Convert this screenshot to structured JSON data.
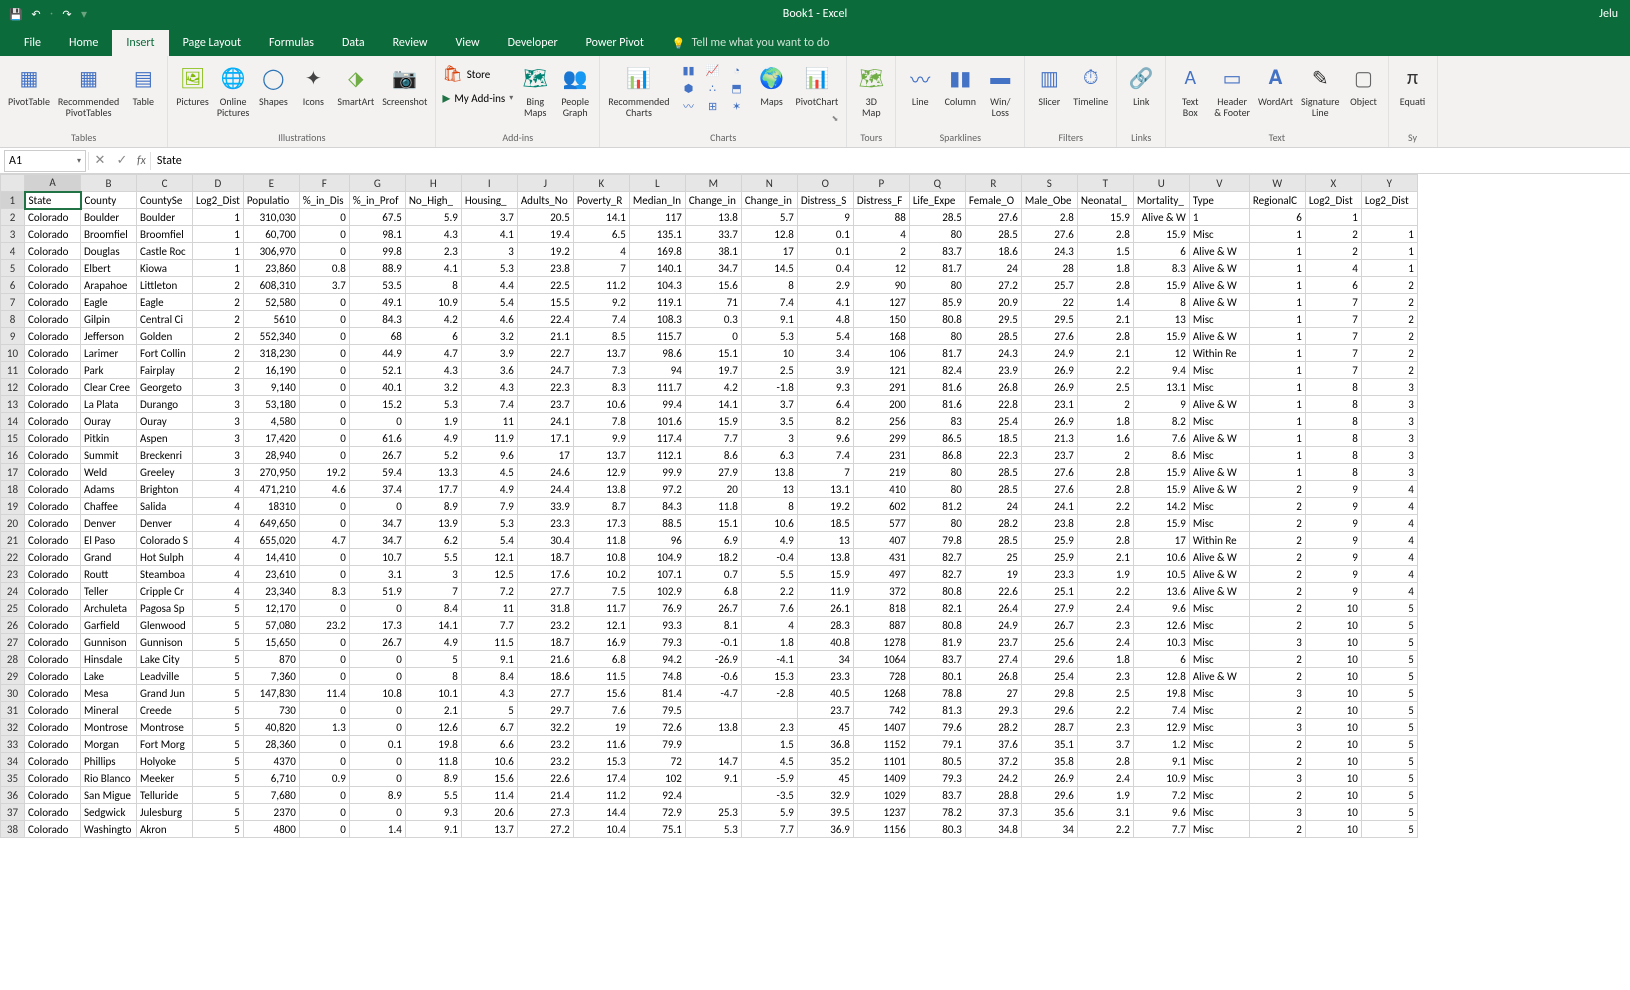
{
  "title": "Book1 - Excel",
  "user": "Jelu",
  "qat": {
    "save": "💾",
    "undo": "↶",
    "redo": "↷"
  },
  "tabs": [
    "File",
    "Home",
    "Insert",
    "Page Layout",
    "Formulas",
    "Data",
    "Review",
    "View",
    "Developer",
    "Power Pivot"
  ],
  "tellme": "Tell me what you want to do",
  "ribbon_groups": {
    "tables": "Tables",
    "illustrations": "Illustrations",
    "addins": "Add-ins",
    "charts": "Charts",
    "tours": "Tours",
    "sparklines": "Sparklines",
    "filters": "Filters",
    "links": "Links",
    "text": "Text",
    "symbols": "Sy"
  },
  "ribbon_btns": {
    "pivot": "PivotTable",
    "recpivot": "Recommended\nPivotTables",
    "table": "Table",
    "pictures": "Pictures",
    "online": "Online\nPictures",
    "shapes": "Shapes",
    "icons": "Icons",
    "smartart": "SmartArt",
    "screenshot": "Screenshot",
    "store": "Store",
    "myaddins": "My Add-ins",
    "bing": "Bing\nMaps",
    "people": "People\nGraph",
    "reccharts": "Recommended\nCharts",
    "maps": "Maps",
    "pivotchart": "PivotChart",
    "3dmap": "3D\nMap",
    "line": "Line",
    "column": "Column",
    "winloss": "Win/\nLoss",
    "slicer": "Slicer",
    "timeline": "Timeline",
    "link": "Link",
    "textbox": "Text\nBox",
    "header": "Header\n& Footer",
    "wordart": "WordArt",
    "signature": "Signature\nLine",
    "object": "Object",
    "equation": "Equati"
  },
  "namebox": "A1",
  "formula": "State",
  "columns": [
    "A",
    "B",
    "C",
    "D",
    "E",
    "F",
    "G",
    "H",
    "I",
    "J",
    "K",
    "L",
    "M",
    "N",
    "O",
    "P",
    "Q",
    "R",
    "S",
    "T",
    "U",
    "V",
    "W",
    "X",
    "Y"
  ],
  "headers": [
    "State",
    "County",
    "CountySe",
    "Log2_Dist",
    "Populatio",
    "%_in_Dis",
    "%_in_Prof",
    "No_High_",
    "Housing_",
    "Adults_No",
    "Poverty_R",
    "Median_In",
    "Change_in",
    "Change_in",
    "Distress_S",
    "Distress_F",
    "Life_Expe",
    "Female_O",
    "Male_Obe",
    "Neonatal_",
    "Mortality_",
    "Type",
    "RegionalC",
    "Log2_Dist",
    "Log2_Dist"
  ],
  "rows": [
    [
      "Colorado",
      "Boulder",
      "Boulder",
      1,
      "310,030",
      0,
      67.5,
      5.9,
      3.7,
      20.5,
      14.1,
      117,
      13.8,
      5.7,
      9,
      88,
      28.5,
      27.6,
      2.8,
      15.9,
      "Alive & W",
      1,
      6,
      1
    ],
    [
      "Colorado",
      "Broomfiel",
      "Broomfiel",
      1,
      "60,700",
      0,
      98.1,
      4.3,
      4.1,
      19.4,
      6.5,
      135.1,
      33.7,
      12.8,
      0.1,
      4,
      80,
      28.5,
      27.6,
      2.8,
      15.9,
      "Misc",
      1,
      2,
      1
    ],
    [
      "Colorado",
      "Douglas",
      "Castle Roc",
      1,
      "306,970",
      0,
      99.8,
      2.3,
      3,
      19.2,
      4,
      169.8,
      38.1,
      17,
      0.1,
      2,
      83.7,
      18.6,
      24.3,
      1.5,
      6,
      "Alive & W",
      1,
      2,
      1
    ],
    [
      "Colorado",
      "Elbert",
      "Kiowa",
      1,
      "23,860",
      0.8,
      88.9,
      4.1,
      5.3,
      23.8,
      7,
      140.1,
      34.7,
      14.5,
      0.4,
      12,
      81.7,
      24,
      28,
      1.8,
      8.3,
      "Alive & W",
      1,
      4,
      1
    ],
    [
      "Colorado",
      "Arapahoe",
      "Littleton",
      2,
      "608,310",
      3.7,
      53.5,
      8,
      4.4,
      22.5,
      11.2,
      104.3,
      15.6,
      8,
      2.9,
      90,
      80,
      27.2,
      25.7,
      2.8,
      15.9,
      "Alive & W",
      1,
      6,
      2
    ],
    [
      "Colorado",
      "Eagle",
      "Eagle",
      2,
      "52,580",
      0,
      49.1,
      10.9,
      5.4,
      15.5,
      9.2,
      119.1,
      71,
      7.4,
      4.1,
      127,
      85.9,
      20.9,
      22,
      1.4,
      8,
      "Alive & W",
      1,
      7,
      2
    ],
    [
      "Colorado",
      "Gilpin",
      "Central Ci",
      2,
      5610,
      0,
      84.3,
      4.2,
      4.6,
      22.4,
      7.4,
      108.3,
      0.3,
      9.1,
      4.8,
      150,
      80.8,
      29.5,
      29.5,
      2.1,
      13,
      "Misc",
      1,
      7,
      2
    ],
    [
      "Colorado",
      "Jefferson",
      "Golden",
      2,
      "552,340",
      0,
      68,
      6,
      3.2,
      21.1,
      8.5,
      115.7,
      0,
      5.3,
      5.4,
      168,
      80,
      28.5,
      27.6,
      2.8,
      15.9,
      "Alive & W",
      1,
      7,
      2
    ],
    [
      "Colorado",
      "Larimer",
      "Fort Collin",
      2,
      "318,230",
      0,
      44.9,
      4.7,
      3.9,
      22.7,
      13.7,
      98.6,
      15.1,
      10,
      3.4,
      106,
      81.7,
      24.3,
      24.9,
      2.1,
      12,
      "Within Re",
      1,
      7,
      2
    ],
    [
      "Colorado",
      "Park",
      "Fairplay",
      2,
      "16,190",
      0,
      52.1,
      4.3,
      3.6,
      24.7,
      7.3,
      94,
      19.7,
      2.5,
      3.9,
      121,
      82.4,
      23.9,
      26.9,
      2.2,
      9.4,
      "Misc",
      1,
      7,
      2
    ],
    [
      "Colorado",
      "Clear Cree",
      "Georgeto",
      3,
      "9,140",
      0,
      40.1,
      3.2,
      4.3,
      22.3,
      8.3,
      111.7,
      4.2,
      -1.8,
      9.3,
      291,
      81.6,
      26.8,
      26.9,
      2.5,
      13.1,
      "Misc",
      1,
      8,
      3
    ],
    [
      "Colorado",
      "La Plata",
      "Durango",
      3,
      "53,180",
      0,
      15.2,
      5.3,
      7.4,
      23.7,
      10.6,
      99.4,
      14.1,
      3.7,
      6.4,
      200,
      81.6,
      22.8,
      23.1,
      2,
      9,
      "Alive & W",
      1,
      8,
      3
    ],
    [
      "Colorado",
      "Ouray",
      "Ouray",
      3,
      "4,580",
      0,
      0,
      1.9,
      11,
      24.1,
      7.8,
      101.6,
      15.9,
      3.5,
      8.2,
      256,
      83,
      25.4,
      26.9,
      1.8,
      8.2,
      "Misc",
      1,
      8,
      3
    ],
    [
      "Colorado",
      "Pitkin",
      "Aspen",
      3,
      "17,420",
      0,
      61.6,
      4.9,
      11.9,
      17.1,
      9.9,
      117.4,
      7.7,
      3,
      9.6,
      299,
      86.5,
      18.5,
      21.3,
      1.6,
      7.6,
      "Alive & W",
      1,
      8,
      3
    ],
    [
      "Colorado",
      "Summit",
      "Breckenri",
      3,
      "28,940",
      0,
      26.7,
      5.2,
      9.6,
      17,
      13.7,
      112.1,
      8.6,
      6.3,
      7.4,
      231,
      86.8,
      22.3,
      23.7,
      2,
      8.6,
      "Misc",
      1,
      8,
      3
    ],
    [
      "Colorado",
      "Weld",
      "Greeley",
      3,
      "270,950",
      19.2,
      59.4,
      13.3,
      4.5,
      24.6,
      12.9,
      99.9,
      27.9,
      13.8,
      7,
      219,
      80,
      28.5,
      27.6,
      2.8,
      15.9,
      "Alive & W",
      1,
      8,
      3
    ],
    [
      "Colorado",
      "Adams",
      "Brighton",
      4,
      "471,210",
      4.6,
      37.4,
      17.7,
      4.9,
      24.4,
      13.8,
      97.2,
      20,
      13,
      13.1,
      410,
      80,
      28.5,
      27.6,
      2.8,
      15.9,
      "Alive & W",
      2,
      9,
      4
    ],
    [
      "Colorado",
      "Chaffee",
      "Salida",
      4,
      18310,
      0,
      0,
      8.9,
      7.9,
      33.9,
      8.7,
      84.3,
      11.8,
      8,
      19.2,
      602,
      81.2,
      24,
      24.1,
      2.2,
      14.2,
      "Misc",
      2,
      9,
      4
    ],
    [
      "Colorado",
      "Denver",
      "Denver",
      4,
      "649,650",
      0,
      34.7,
      13.9,
      5.3,
      23.3,
      17.3,
      88.5,
      15.1,
      10.6,
      18.5,
      577,
      80,
      28.2,
      23.8,
      2.8,
      15.9,
      "Misc",
      2,
      9,
      4
    ],
    [
      "Colorado",
      "El Paso",
      "Colorado S",
      4,
      "655,020",
      4.7,
      34.7,
      6.2,
      5.4,
      30.4,
      11.8,
      96,
      6.9,
      4.9,
      13,
      407,
      79.8,
      28.5,
      25.9,
      2.8,
      17,
      "Within Re",
      2,
      9,
      4
    ],
    [
      "Colorado",
      "Grand",
      "Hot Sulph",
      4,
      "14,410",
      0,
      10.7,
      5.5,
      12.1,
      18.7,
      10.8,
      104.9,
      18.2,
      -0.4,
      13.8,
      431,
      82.7,
      25,
      25.9,
      2.1,
      10.6,
      "Alive & W",
      2,
      9,
      4
    ],
    [
      "Colorado",
      "Routt",
      "Steamboa",
      4,
      "23,610",
      0,
      3.1,
      3,
      12.5,
      17.6,
      10.2,
      107.1,
      0.7,
      5.5,
      15.9,
      497,
      82.7,
      19,
      23.3,
      1.9,
      10.5,
      "Alive & W",
      2,
      9,
      4
    ],
    [
      "Colorado",
      "Teller",
      "Cripple Cr",
      4,
      "23,340",
      8.3,
      51.9,
      7,
      7.2,
      27.7,
      7.5,
      102.9,
      6.8,
      2.2,
      11.9,
      372,
      80.8,
      22.6,
      25.1,
      2.2,
      13.6,
      "Alive & W",
      2,
      9,
      4
    ],
    [
      "Colorado",
      "Archuleta",
      "Pagosa Sp",
      5,
      "12,170",
      0,
      0,
      8.4,
      11,
      31.8,
      11.7,
      76.9,
      26.7,
      7.6,
      26.1,
      818,
      82.1,
      26.4,
      27.9,
      2.4,
      9.6,
      "Misc",
      2,
      10,
      5
    ],
    [
      "Colorado",
      "Garfield",
      "Glenwood",
      5,
      "57,080",
      23.2,
      17.3,
      14.1,
      7.7,
      23.2,
      12.1,
      93.3,
      8.1,
      4,
      28.3,
      887,
      80.8,
      24.9,
      26.7,
      2.3,
      12.6,
      "Misc",
      2,
      10,
      5
    ],
    [
      "Colorado",
      "Gunnison",
      "Gunnison",
      5,
      "15,650",
      0,
      26.7,
      4.9,
      11.5,
      18.7,
      16.9,
      79.3,
      -0.1,
      1.8,
      40.8,
      1278,
      81.9,
      23.7,
      25.6,
      2.4,
      10.3,
      "Misc",
      3,
      10,
      5
    ],
    [
      "Colorado",
      "Hinsdale",
      "Lake City",
      5,
      870,
      0,
      0,
      5,
      9.1,
      21.6,
      6.8,
      94.2,
      -26.9,
      -4.1,
      34,
      1064,
      83.7,
      27.4,
      29.6,
      1.8,
      6,
      "Misc",
      2,
      10,
      5
    ],
    [
      "Colorado",
      "Lake",
      "Leadville",
      5,
      "7,360",
      0,
      0,
      8,
      8.4,
      18.6,
      11.5,
      74.8,
      -0.6,
      15.3,
      23.3,
      728,
      80.1,
      26.8,
      25.4,
      2.3,
      12.8,
      "Alive & W",
      2,
      10,
      5
    ],
    [
      "Colorado",
      "Mesa",
      "Grand Jun",
      5,
      "147,830",
      11.4,
      10.8,
      10.1,
      4.3,
      27.7,
      15.6,
      81.4,
      -4.7,
      -2.8,
      40.5,
      1268,
      78.8,
      27,
      29.8,
      2.5,
      19.8,
      "Misc",
      3,
      10,
      5
    ],
    [
      "Colorado",
      "Mineral",
      "Creede",
      5,
      730,
      0,
      0,
      2.1,
      5,
      29.7,
      7.6,
      79.5,
      "",
      "",
      23.7,
      742,
      81.3,
      29.3,
      29.6,
      2.2,
      7.4,
      "Misc",
      2,
      10,
      5
    ],
    [
      "Colorado",
      "Montrose",
      "Montrose",
      5,
      "40,820",
      1.3,
      0,
      12.6,
      6.7,
      32.2,
      19,
      72.6,
      13.8,
      2.3,
      45,
      1407,
      79.6,
      28.2,
      28.7,
      2.3,
      12.9,
      "Misc",
      3,
      10,
      5
    ],
    [
      "Colorado",
      "Morgan",
      "Fort Morg",
      5,
      "28,360",
      0,
      0.1,
      19.8,
      6.6,
      23.2,
      11.6,
      79.9,
      "",
      1.5,
      36.8,
      1152,
      79.1,
      37.6,
      35.1,
      3.7,
      1.2,
      "Misc",
      2,
      10,
      5
    ],
    [
      "Colorado",
      "Phillips",
      "Holyoke",
      5,
      4370,
      0,
      0,
      11.8,
      10.6,
      23.2,
      15.3,
      72,
      14.7,
      4.5,
      35.2,
      1101,
      80.5,
      37.2,
      35.8,
      2.8,
      9.1,
      "Misc",
      2,
      10,
      5
    ],
    [
      "Colorado",
      "Rio Blanco",
      "Meeker",
      5,
      "6,710",
      0.9,
      0,
      8.9,
      15.6,
      22.6,
      17.4,
      102,
      9.1,
      -5.9,
      45,
      1409,
      79.3,
      24.2,
      26.9,
      2.4,
      10.9,
      "Misc",
      3,
      10,
      5
    ],
    [
      "Colorado",
      "San Migue",
      "Telluride",
      5,
      "7,680",
      0,
      8.9,
      5.5,
      11.4,
      21.4,
      11.2,
      92.4,
      "",
      -3.5,
      32.9,
      1029,
      83.7,
      28.8,
      29.6,
      1.9,
      7.2,
      "Misc",
      2,
      10,
      5
    ],
    [
      "Colorado",
      "Sedgwick",
      "Julesburg",
      5,
      2370,
      0,
      0,
      9.3,
      20.6,
      27.3,
      14.4,
      72.9,
      25.3,
      5.9,
      39.5,
      1237,
      78.2,
      37.3,
      35.6,
      3.1,
      9.6,
      "Misc",
      3,
      10,
      5
    ],
    [
      "Colorado",
      "Washingto",
      "Akron",
      5,
      4800,
      0,
      1.4,
      9.1,
      13.7,
      27.2,
      10.4,
      75.1,
      5.3,
      7.7,
      36.9,
      1156,
      80.3,
      34.8,
      34,
      2.2,
      7.7,
      "Misc",
      2,
      10,
      5
    ]
  ],
  "numeric_cols": [
    3,
    4,
    5,
    6,
    7,
    8,
    9,
    10,
    11,
    12,
    13,
    14,
    15,
    16,
    17,
    18,
    19,
    20,
    22,
    23,
    24
  ]
}
